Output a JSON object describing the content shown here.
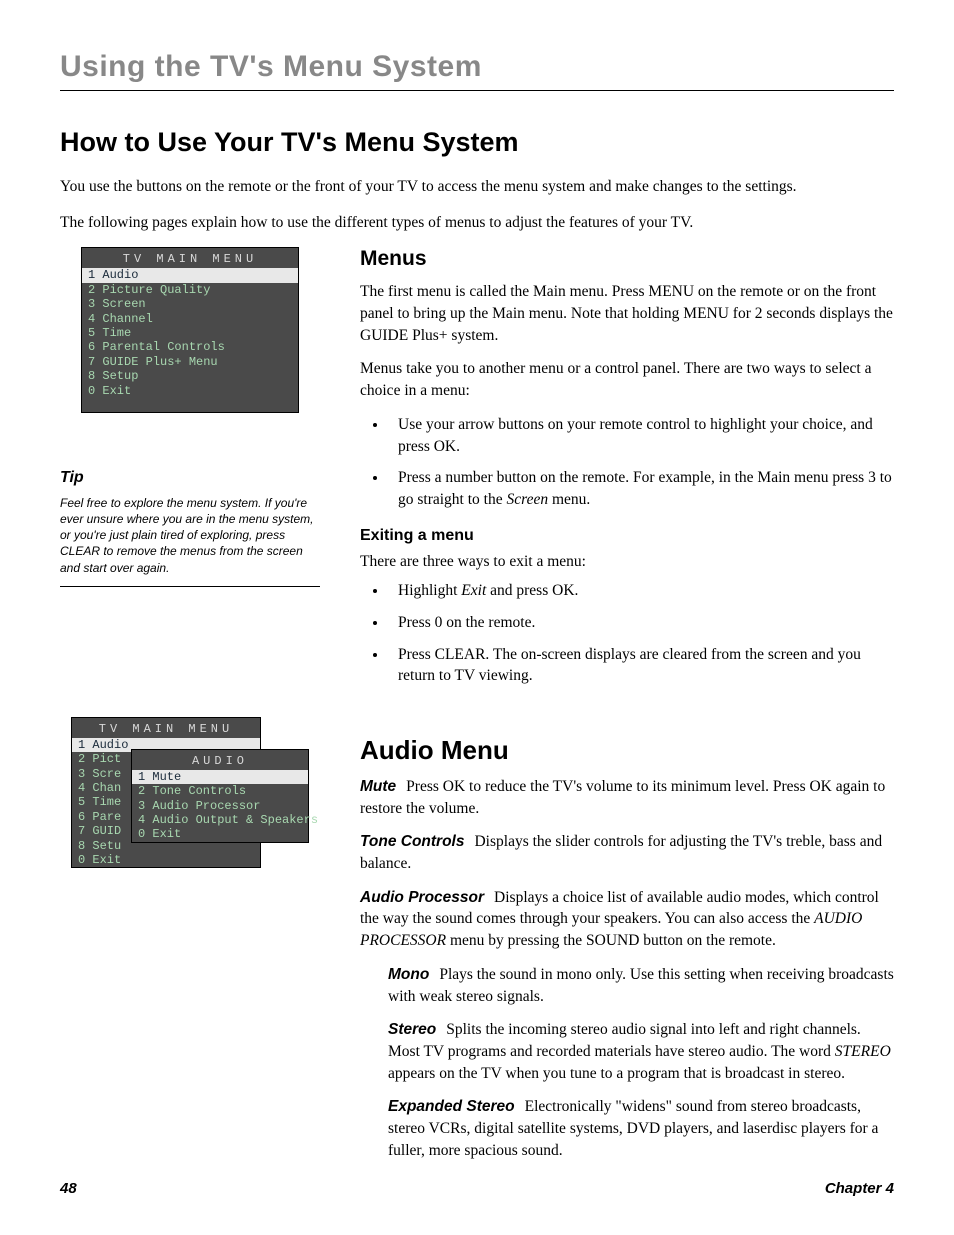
{
  "chapter_header": "Using the TV's Menu System",
  "page_heading": "How to Use Your TV's Menu System",
  "intro1": "You use the buttons on the remote or the front of your TV to access the menu system and make changes to the settings.",
  "intro2": "The following pages explain how to use the different types of menus to adjust the features of your TV.",
  "main_menu": {
    "title": "TV MAIN MENU",
    "items": [
      "1 Audio",
      "2 Picture Quality",
      "3 Screen",
      "4 Channel",
      "5 Time",
      "6 Parental Controls",
      "7 GUIDE Plus+ Menu",
      "8 Setup",
      "0 Exit"
    ]
  },
  "tip": {
    "heading": "Tip",
    "body": "Feel free to explore the menu system. If you're ever unsure where you are in the menu system, or you're just plain tired of exploring, press CLEAR to remove the menus from the screen and start over again."
  },
  "menus": {
    "heading": "Menus",
    "p1": "The first menu is called the Main menu. Press MENU on the remote or on the front panel to bring up the Main menu. Note that holding MENU for 2 seconds displays the GUIDE Plus+ system.",
    "p2": "Menus take you to another menu or a control panel. There are two ways to select a choice in a menu:",
    "b1": "Use your arrow buttons on your remote control to highlight your choice, and press OK.",
    "b2_a": "Press a number button on the remote. For example, in the Main menu press 3 to go straight to the ",
    "b2_i": "Screen",
    "b2_b": " menu."
  },
  "exiting": {
    "heading": "Exiting a menu",
    "lead": "There are three ways to exit a menu:",
    "b1_a": "Highlight ",
    "b1_i": "Exit",
    "b1_b": " and press OK.",
    "b2": "Press 0 on the remote.",
    "b3": "Press CLEAR. The on-screen displays are cleared from the screen and you return to TV viewing."
  },
  "sub_menu": {
    "main_title": "TV MAIN MENU",
    "main_items": [
      "1 Audio",
      "2 Pict",
      "3 Scre",
      "4 Chan",
      "5 Time",
      "6 Pare",
      "7 GUID",
      "8 Setu",
      "0 Exit"
    ],
    "audio_title": "AUDIO",
    "audio_items": [
      "1 Mute",
      "2 Tone Controls",
      "3 Audio Processor",
      "4 Audio Output & Speakers",
      "0 Exit"
    ]
  },
  "audio": {
    "heading": "Audio Menu",
    "mute_term": "Mute",
    "mute_text": "Press OK to reduce the TV's volume to its minimum level. Press OK again to restore the volume.",
    "tone_term": "Tone Controls",
    "tone_text": "Displays the slider controls for adjusting the TV's treble, bass and balance.",
    "ap_term": "Audio Processor",
    "ap_text_a": "Displays a choice list of available audio modes, which control the way the sound comes through your speakers. You can also access the ",
    "ap_text_i": "AUDIO PROCESSOR",
    "ap_text_b": " menu by pressing the SOUND button on the remote.",
    "mono_term": "Mono",
    "mono_text": "Plays the sound in mono only. Use this setting when receiving broadcasts with weak stereo signals.",
    "stereo_term": "Stereo",
    "stereo_text_a": "Splits the incoming stereo audio signal into left and right channels. Most TV programs and recorded materials have stereo audio. The word ",
    "stereo_text_i": "STEREO",
    "stereo_text_b": " appears on the TV when you tune to a program that is broadcast in stereo.",
    "exp_term": "Expanded Stereo",
    "exp_text": "Electronically \"widens\" sound from stereo broadcasts, stereo VCRs, digital satellite systems, DVD players, and laserdisc players for a fuller, more spacious sound."
  },
  "footer": {
    "page": "48",
    "chapter": "Chapter 4"
  }
}
